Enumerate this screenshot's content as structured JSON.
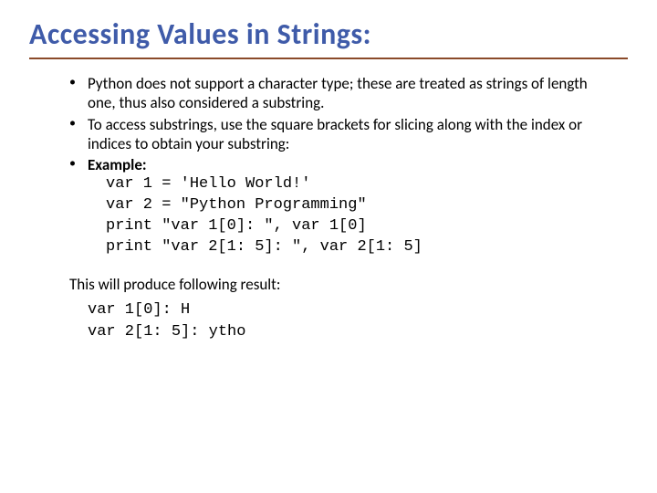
{
  "title": "Accessing Values in Strings:",
  "bullets": {
    "b1": "Python does not support a character type; these are treated as strings of length one, thus also considered a substring.",
    "b2": "To access substrings, use the square brackets for slicing along with the index or indices to obtain your substring:",
    "b3_label": "Example:"
  },
  "code": {
    "l1": "var 1 = 'Hello World!'",
    "l2": "var 2 = \"Python Programming\"",
    "l3": "print \"var 1[0]: \", var 1[0]",
    "l4": "print \"var 2[1: 5]: \", var 2[1: 5]"
  },
  "result_intro": "This will produce following result:",
  "result": {
    "r1": "var 1[0]: H",
    "r2": "var 2[1: 5]: ytho"
  }
}
